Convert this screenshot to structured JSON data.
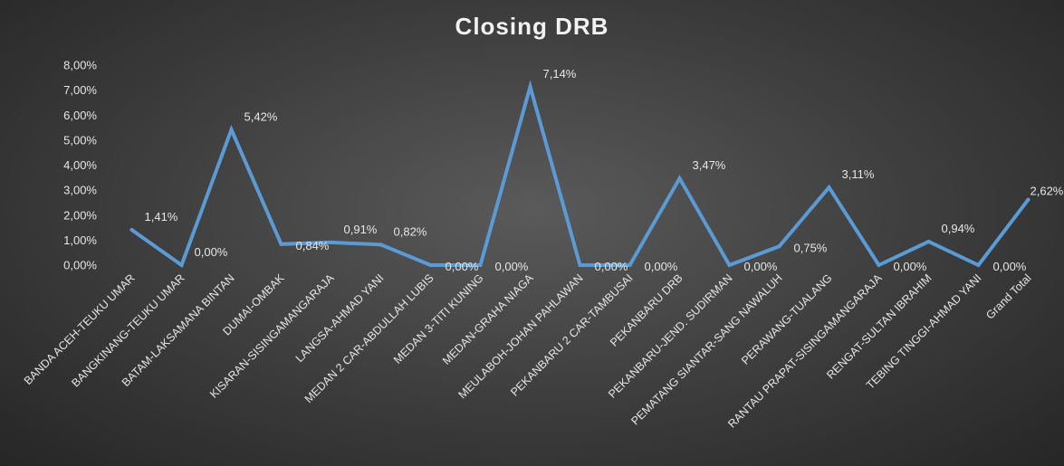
{
  "chart_data": {
    "type": "line",
    "title": "Closing DRB",
    "xlabel": "",
    "ylabel": "",
    "ylim": [
      0,
      8
    ],
    "y_ticks": [
      "0,00%",
      "1,00%",
      "2,00%",
      "3,00%",
      "4,00%",
      "5,00%",
      "6,00%",
      "7,00%",
      "8,00%"
    ],
    "grid": false,
    "legend": "none",
    "line_color": "#5b9bd5",
    "categories": [
      "BANDA ACEH-TEUKU UMAR",
      "BANGKINANG-TEUKU UMAR",
      "BATAM-LAKSAMANA BINTAN",
      "DUMAI-OMBAK",
      "KISARAN-SISINGAMANGARAJA",
      "LANGSA-AHMAD YANI",
      "MEDAN 2 CAR-ABDULLAH LUBIS",
      "MEDAN 3-TITI KUNING",
      "MEDAN-GRAHA NIAGA",
      "MEULABOH-JOHAN PAHLAWAN",
      "PEKANBARU 2 CAR-TAMBUSAI",
      "PEKANBARU DRB",
      "PEKANBARU-JEND. SUDIRMAN",
      "PEMATANG SIANTAR-SANG NAWALUH",
      "PERAWANG-TUALANG",
      "RANTAU PRAPAT-SISINGAMANGARAJA",
      "RENGAT-SULTAN IBRAHIM",
      "TEBING TINGGI-AHMAD YANI",
      "Grand Total"
    ],
    "values": [
      1.41,
      0.0,
      5.42,
      0.84,
      0.91,
      0.82,
      0.0,
      0.0,
      7.14,
      0.0,
      0.0,
      3.47,
      0.0,
      0.75,
      3.11,
      0.0,
      0.94,
      0.0,
      2.62
    ],
    "data_labels": [
      "1,41%",
      "0,00%",
      "5,42%",
      "0,84%",
      "0,91%",
      "0,82%",
      "0,00%",
      "0,00%",
      "7,14%",
      "0,00%",
      "0,00%",
      "3,47%",
      "0,00%",
      "0,75%",
      "3,11%",
      "0,00%",
      "0,94%",
      "0,00%",
      "2,62%"
    ],
    "data_label_sides": [
      "right",
      "right",
      "right",
      "below",
      "right",
      "right",
      "below",
      "below",
      "right",
      "below",
      "below",
      "right",
      "below",
      "below",
      "right",
      "below",
      "right",
      "below",
      "right"
    ]
  }
}
